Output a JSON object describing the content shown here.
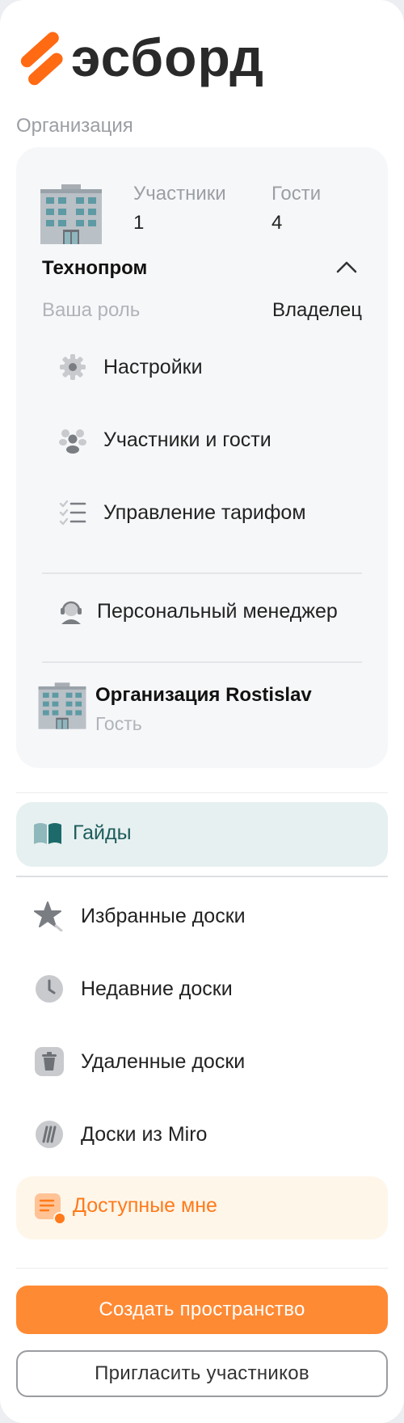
{
  "brand": {
    "name": "эсборд",
    "accent": "#ff6a13"
  },
  "org_section_label": "Организация",
  "current_org": {
    "members_label": "Участники",
    "members_count": "1",
    "guests_label": "Гости",
    "guests_count": "4",
    "name": "Технопром",
    "role_label": "Ваша роль",
    "role_value": "Владелец",
    "menu": [
      {
        "label": "Настройки",
        "icon": "gear-icon"
      },
      {
        "label": "Участники и гости",
        "icon": "people-icon"
      },
      {
        "label": "Управление тарифом",
        "icon": "checklist-icon"
      }
    ],
    "manager_label": "Персональный менеджер"
  },
  "other_org": {
    "name": "Организация Rostislav",
    "role": "Гость"
  },
  "nav": {
    "guides": "Гайды",
    "favorites": "Избранные доски",
    "recent": "Недавние доски",
    "deleted": "Удаленные доски",
    "miro": "Доски из Miro",
    "shared": "Доступные мне"
  },
  "actions": {
    "create_space": "Создать пространство",
    "invite": "Пригласить участников"
  },
  "colors": {
    "guides_bg": "#e7f0f0",
    "guides_text": "#1d5c5c",
    "shared_bg": "#fff6ea",
    "shared_text": "#ff7a1a",
    "primary_button": "#ff8a34"
  }
}
